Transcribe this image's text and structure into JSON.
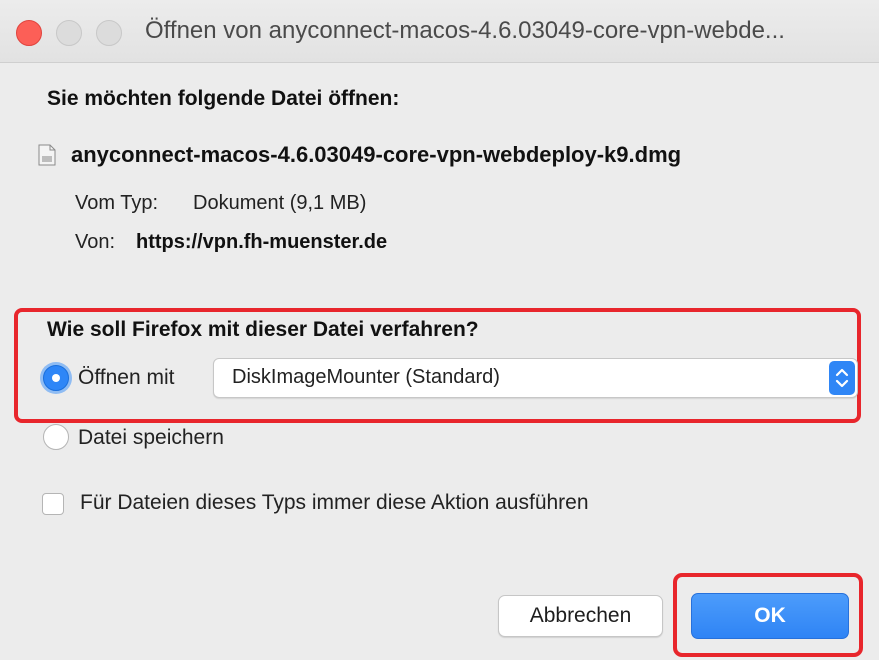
{
  "window": {
    "title": "Öffnen von anyconnect-macos-4.6.03049-core-vpn-webde..."
  },
  "dialog": {
    "heading": "Sie möchten folgende Datei öffnen:",
    "file_name": "anyconnect-macos-4.6.03049-core-vpn-webdeploy-k9.dmg",
    "type_label": "Vom Typ:",
    "type_value": "Dokument (9,1 MB)",
    "from_label": "Von:",
    "from_value": "https://vpn.fh-muenster.de",
    "question": "Wie soll Firefox mit dieser Datei verfahren?",
    "open_with_label": "Öffnen mit",
    "open_with_app": "DiskImageMounter (Standard)",
    "save_label": "Datei speichern",
    "always_label": "Für Dateien dieses Typs immer diese Aktion ausführen"
  },
  "buttons": {
    "cancel": "Abbrechen",
    "ok": "OK"
  },
  "state": {
    "selected_option": "open_with",
    "always_checked": false
  },
  "colors": {
    "accent": "#2f86f6",
    "highlight": "#e8262c",
    "close": "#fc5f57"
  }
}
